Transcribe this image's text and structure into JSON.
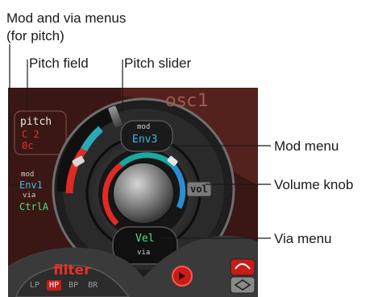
{
  "callouts": {
    "mod_via_line1": "Mod and via menus",
    "mod_via_line2": "(for pitch)",
    "pitch_field": "Pitch field",
    "pitch_slider": "Pitch slider",
    "mod_menu": "Mod menu",
    "volume_knob": "Volume knob",
    "via_menu": "Via menu"
  },
  "synth": {
    "osc_title": "osc1",
    "pitch": {
      "label": "pitch",
      "coarse": "C 2",
      "fine": "0c"
    },
    "pitch_mod": {
      "mod_label": "mod",
      "mod_value": "Env1",
      "via_label": "via",
      "via_value": "CtrlA"
    },
    "volume": {
      "mod_label": "mod",
      "mod_value": "Env3",
      "knob_label": "vol",
      "via_value": "Vel",
      "via_label": "via"
    },
    "filter": {
      "title": "filter",
      "modes": [
        "LP",
        "HP",
        "BP",
        "BR"
      ],
      "selected_mode": "HP"
    }
  },
  "colors": {
    "panel_red": "#4a1e1a",
    "lcd_red": "#e63228",
    "lcd_cyan": "#3fb7e8",
    "lcd_green": "#4fe08a",
    "lcd_white": "#e8e8e8"
  }
}
